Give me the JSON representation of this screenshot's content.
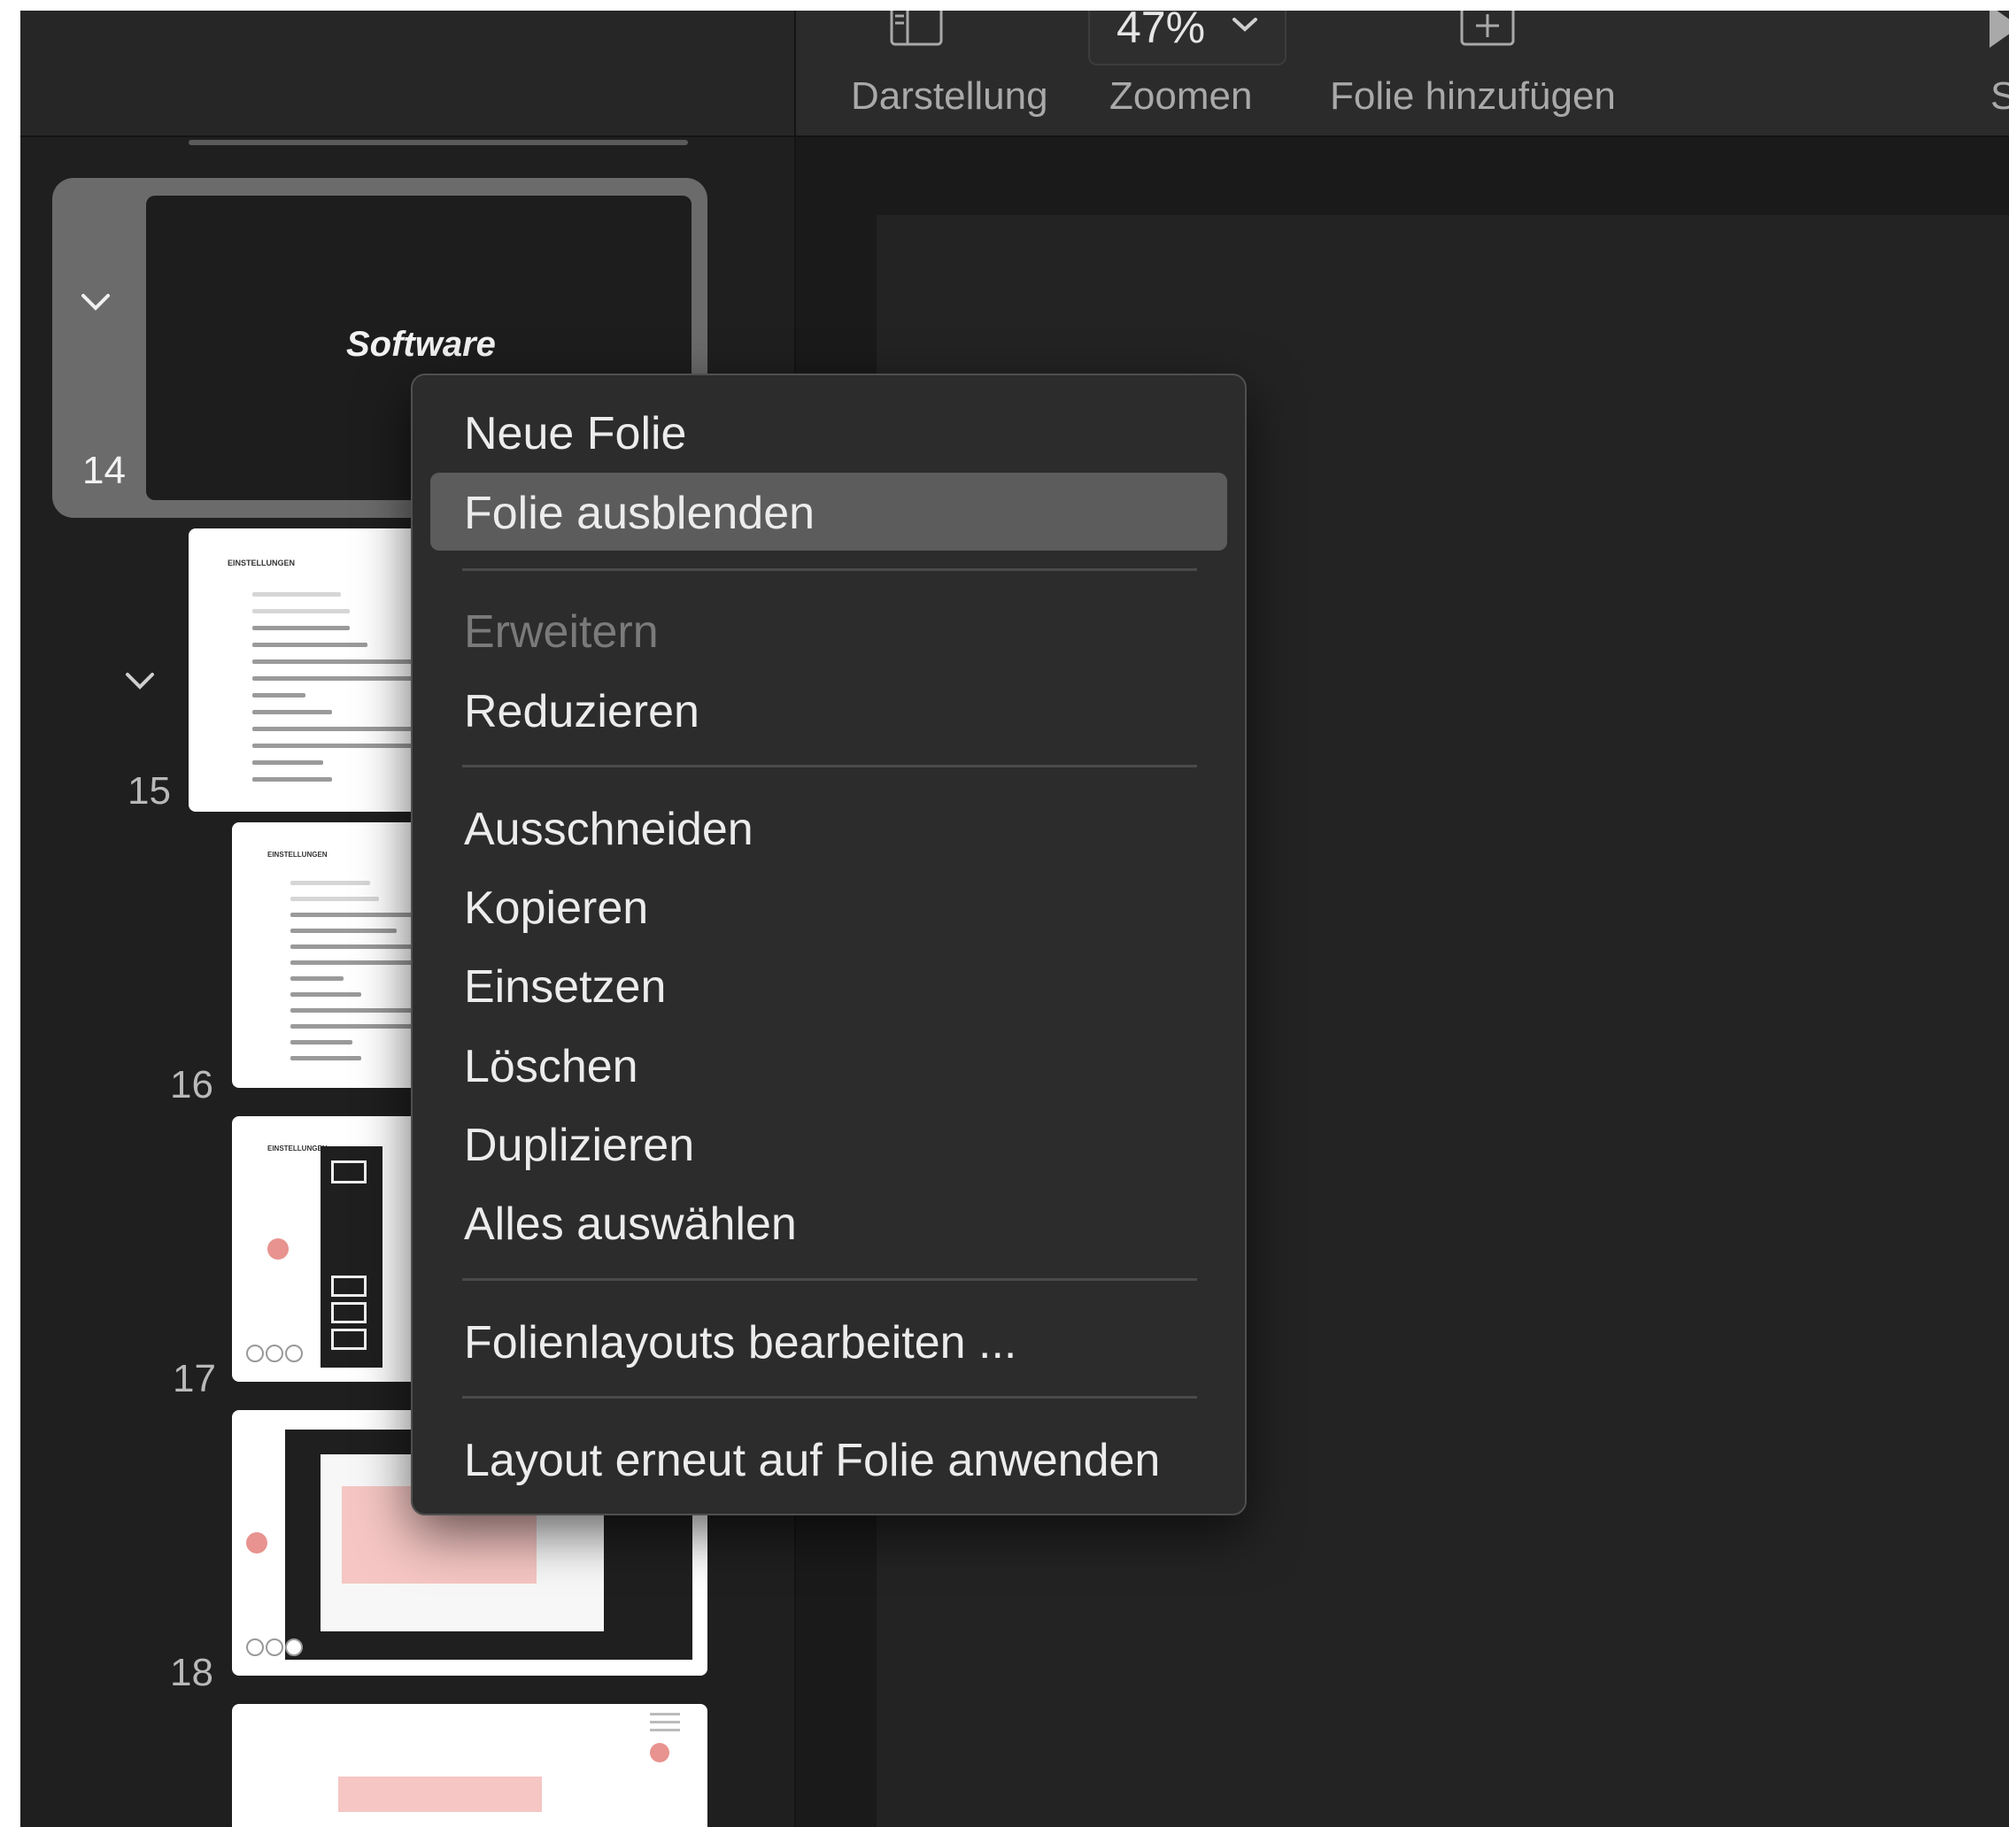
{
  "toolbar": {
    "zoom_value": "47%",
    "view_label": "Darstellung",
    "zoom_label": "Zoomen",
    "add_slide_label": "Folie hinzufügen",
    "play_label": "Sta"
  },
  "sidebar": {
    "slides": [
      {
        "number": "14",
        "title": "Software",
        "selected": true
      },
      {
        "number": "15",
        "heading": "EINSTELLUNGEN"
      },
      {
        "number": "16",
        "heading": "EINSTELLUNGEN"
      },
      {
        "number": "17",
        "heading": "EINSTELLUNGEN"
      },
      {
        "number": "18"
      }
    ]
  },
  "context_menu": {
    "items": [
      {
        "label": "Neue Folie"
      },
      {
        "label": "Folie ausblenden",
        "highlighted": true
      },
      {
        "label": "Erweitern",
        "disabled": true
      },
      {
        "label": "Reduzieren"
      },
      {
        "label": "Ausschneiden"
      },
      {
        "label": "Kopieren"
      },
      {
        "label": "Einsetzen"
      },
      {
        "label": "Löschen"
      },
      {
        "label": "Duplizieren"
      },
      {
        "label": "Alles auswählen"
      },
      {
        "label": "Folienlayouts bearbeiten ..."
      },
      {
        "label": "Layout erneut auf Folie anwenden"
      }
    ]
  },
  "colors": {
    "menu_background": "#2c2c2c",
    "menu_highlight": "#5c5c5c",
    "accent_pink": "#e8938f"
  }
}
